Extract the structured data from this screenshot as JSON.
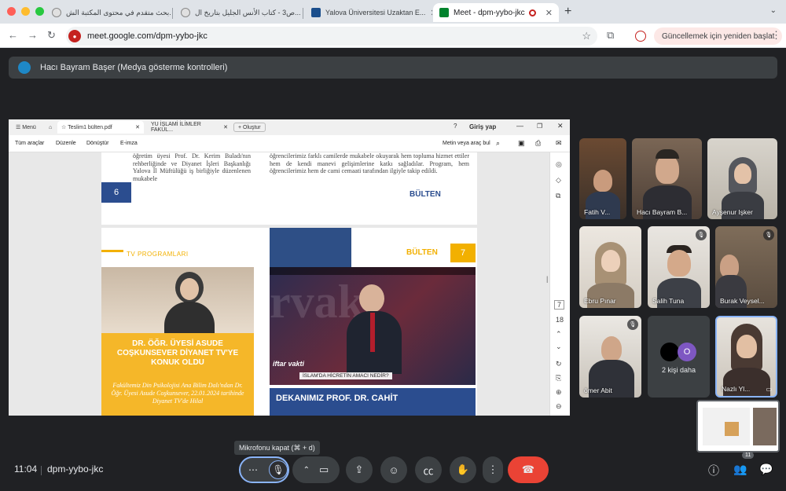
{
  "browser": {
    "tabs": [
      {
        "label": "بحث متقدم في محتوى المكتبة الش..."
      },
      {
        "label": "ص3 - كتاب الأنس الجليل بتاريخ ال..."
      },
      {
        "label": "Yalova Üniversitesi Uzaktan E..."
      },
      {
        "label": "Meet - dpm-yybo-jkc"
      }
    ],
    "url": "meet.google.com/dpm-yybo-jkc",
    "update_label": "Güncellemek için yeniden başlat"
  },
  "presenter": {
    "label": "Hacı Bayram Başer (Medya gösterme kontrolleri)"
  },
  "pdf": {
    "tabs": [
      "Menü",
      "Teslim1 bülten.pdf",
      "YU İSLAMİ İLİMLER FAKÜL...",
      "Oluştur"
    ],
    "login": "Giriş yap",
    "menu": [
      "Tüm araçlar",
      "Düzenle",
      "Dönüştür",
      "E-imza"
    ],
    "search": "Metin veya araç bul",
    "page_num": "7",
    "page_total": "18",
    "page6": {
      "left_text": "öğretim üyesi Prof. Dr. Kerim Buladı'nın rehberliğinde ve Diyanet İşleri Başkanlığı Yalova İl Müftülüğü iş birliğiyle düzenlenen mukabele",
      "right_text": "öğrencilerimiz farklı camilerde mukabele okuyarak hem topluma hizmet ettiler hem de kendi manevi gelişimlerine katkı sağladılar. Program, hem öğrencilerimiz hem de cami cemaati tarafından ilgiyle takip edildi.",
      "number": "6",
      "logo": "BÜLTEN"
    },
    "page7": {
      "section": "TV PROGRAMLARI",
      "logo": "BÜLTEN",
      "number": "7",
      "card_title": "DR. ÖĞR. ÜYESİ ASUDE COŞKUNSEVER DİYANET TV'YE KONUK OLDU",
      "card_desc": "Fakültemiz Din Psikolojisi Ana Bilim Dalı'ndan Dr. Öğr. Üyesi Asude Coşkunsever, 22.01.2024 tarihinde Diyanet TV'de Hilal",
      "tv_caption": "İSLAM'DA HİCRETİN AMACI NEDİR?",
      "tv_show": "iftar vakti",
      "dekan_title": "DEKANIMIZ PROF. DR. CAHİT"
    }
  },
  "participants": [
    {
      "name": "Fatih V..."
    },
    {
      "name": "Hacı Bayram B..."
    },
    {
      "name": "Ayşenur Işker"
    },
    {
      "name": "Ebru Pınar"
    },
    {
      "name": "Salih Tuna"
    },
    {
      "name": "Burak Veysel..."
    },
    {
      "name": "ömer Abit"
    },
    {
      "name": "Nazlı Yl..."
    }
  ],
  "more_people": {
    "label": "2 kişi daha",
    "avatar": "O"
  },
  "controls": {
    "tooltip": "Mikrofonu kapat (⌘ + d)",
    "time": "11:04",
    "meeting_code": "dpm-yybo-jkc",
    "people_badge": "11"
  }
}
